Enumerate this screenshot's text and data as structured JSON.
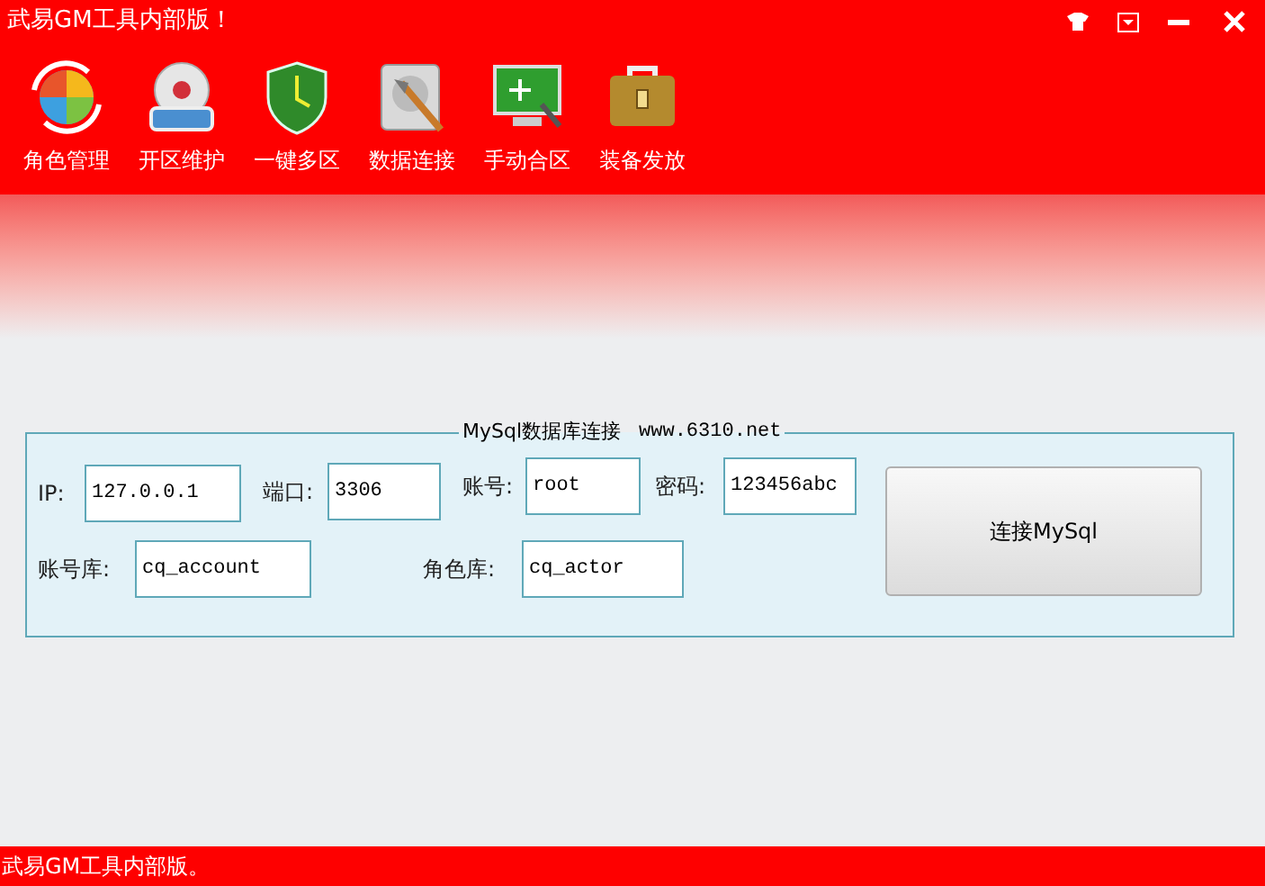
{
  "window": {
    "title": "武易GM工具内部版！"
  },
  "toolbar": [
    {
      "label": "角色管理",
      "kind": "refresh"
    },
    {
      "label": "开区维护",
      "kind": "disc"
    },
    {
      "label": "一键多区",
      "kind": "shield"
    },
    {
      "label": "数据连接",
      "kind": "disk"
    },
    {
      "label": "手动合区",
      "kind": "monitor"
    },
    {
      "label": "装备发放",
      "kind": "briefcase"
    }
  ],
  "group": {
    "title": "MySql数据库连接",
    "link": "www.6310.net",
    "fields": [
      {
        "label": "IP:",
        "value": "127.0.0.1"
      },
      {
        "label": "端口:",
        "value": "3306"
      },
      {
        "label": "账号:",
        "value": "root"
      },
      {
        "label": "密码:",
        "value": "123456abc"
      },
      {
        "label": "账号库:",
        "value": "cq_account"
      },
      {
        "label": "角色库:",
        "value": "cq_actor"
      }
    ],
    "button": "连接MySql"
  },
  "status_bar": "武易GM工具内部版。"
}
